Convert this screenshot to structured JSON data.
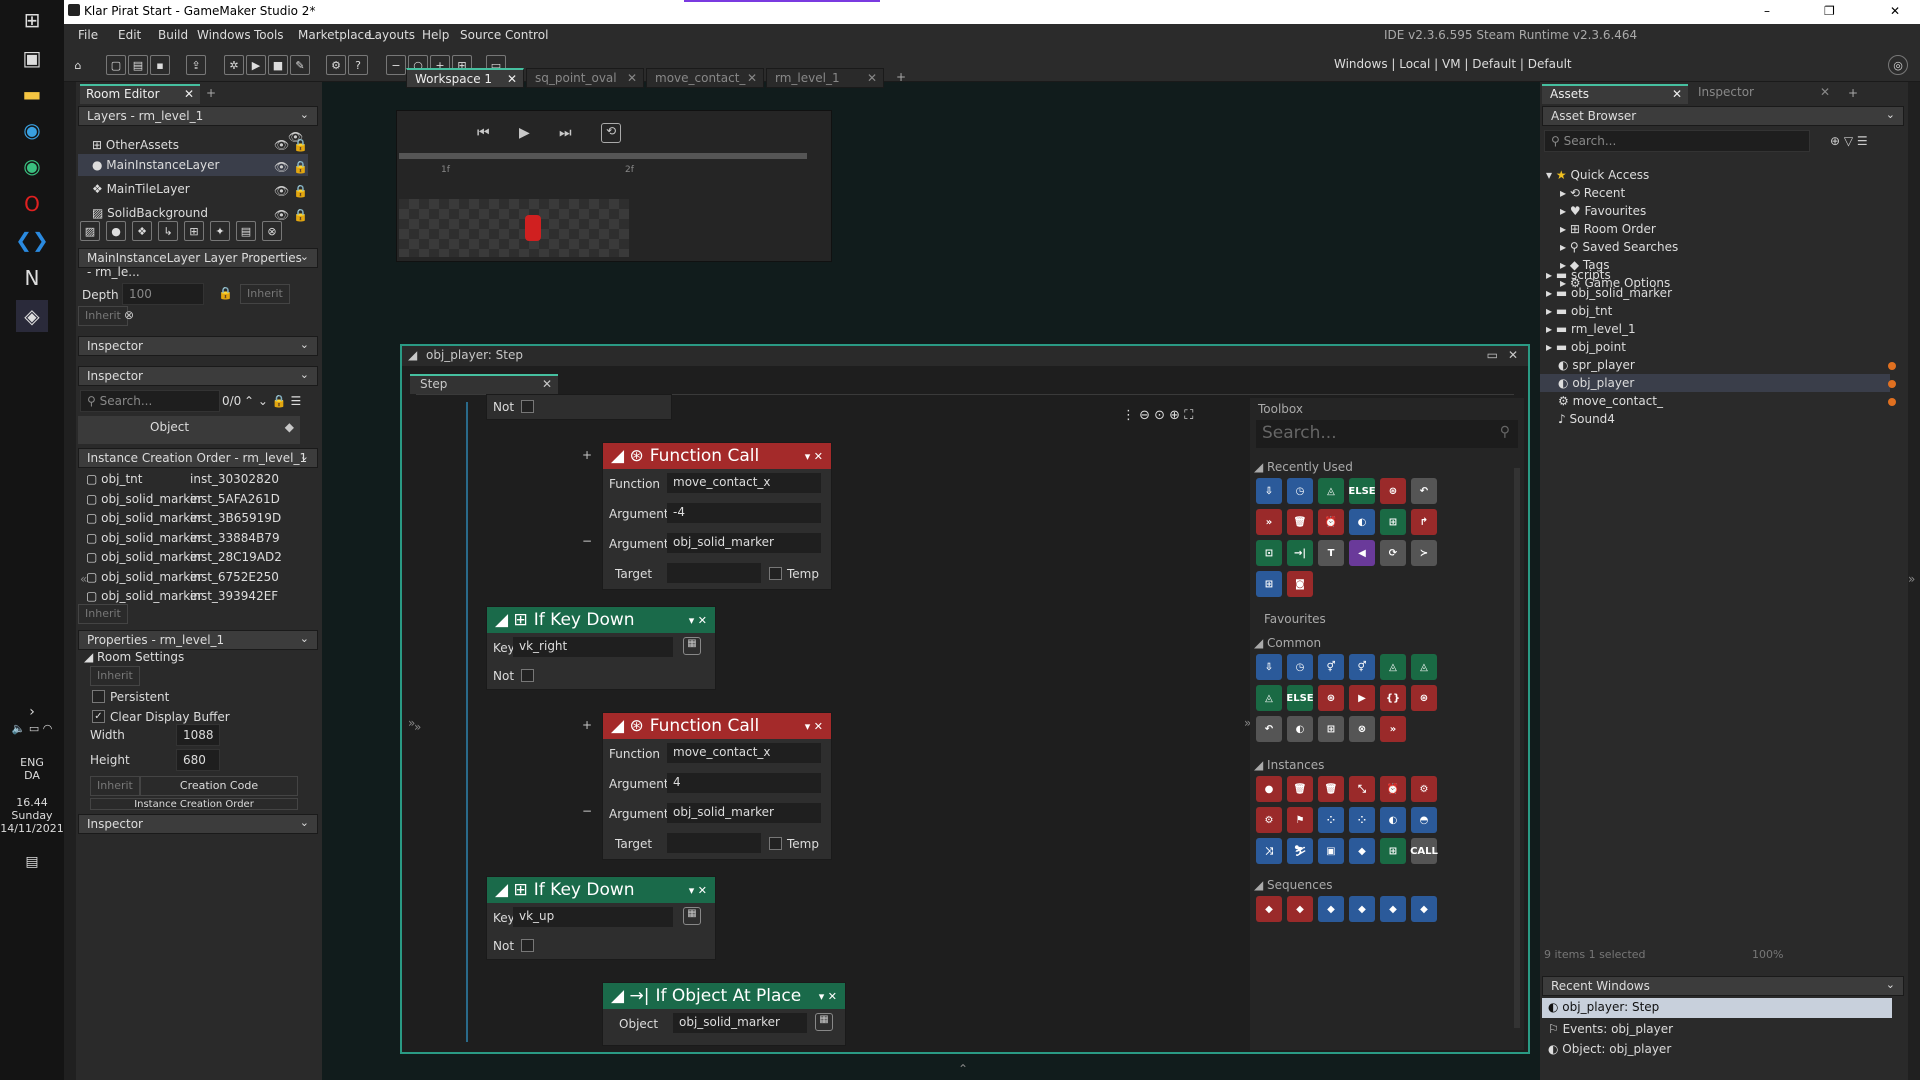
{
  "window": {
    "title": "Klar Pirat Start - GameMaker Studio 2*",
    "version": "IDE v2.3.6.595 Steam  Runtime v2.3.6.464",
    "controls": [
      "–",
      "❐",
      "✕"
    ]
  },
  "menu": [
    "File",
    "Edit",
    "Build",
    "Windows",
    "Tools",
    "Marketplace",
    "Layouts",
    "Help",
    "Source Control"
  ],
  "toolbar_right": "Windows  |  Local  |  VM  |  Default  |  Default",
  "left": {
    "tab": "Room Editor",
    "layers_header": "Layers - rm_level_1",
    "layers": [
      "OtherAssets",
      "MainInstanceLayer",
      "MainTileLayer",
      "SolidBackground"
    ],
    "layer_props": "MainInstanceLayer Layer Properties - rm_le...",
    "depth_label": "Depth",
    "depth_value": "100",
    "inherit": "Inherit",
    "inspector": "Inspector",
    "search": "Search...",
    "count": "0/0",
    "object_label": "Object",
    "ico_header": "Instance Creation Order - rm_level_1",
    "instances": [
      [
        "obj_tnt",
        "inst_30302820"
      ],
      [
        "obj_solid_marker",
        "inst_5AFA261D"
      ],
      [
        "obj_solid_marker",
        "inst_3B65919D"
      ],
      [
        "obj_solid_marker",
        "inst_33884B79"
      ],
      [
        "obj_solid_marker",
        "inst_28C19AD2"
      ],
      [
        "obj_solid_marker",
        "inst_6752E250"
      ],
      [
        "obj_solid_marker",
        "inst_393942EF"
      ]
    ],
    "props_header": "Properties - rm_level_1",
    "room_settings": "Room Settings",
    "persistent": "Persistent",
    "clear_display": "Clear Display Buffer",
    "width_label": "Width",
    "width_value": "1088",
    "height_label": "Height",
    "height_value": "680",
    "creation_code": "Creation Code",
    "instance_order": "Instance Creation Order"
  },
  "tabs": [
    "Workspace 1",
    "sq_point_oval",
    "move_contact_",
    "rm_level_1"
  ],
  "ruler": [
    "1f",
    "2f"
  ],
  "step_window": {
    "title": "obj_player: Step",
    "tab": "Step",
    "not": "Not"
  },
  "nodes": {
    "fc_title": "Function Call",
    "function_label": "Function",
    "function_value": "move_contact_x",
    "argument_label": "Argument",
    "arg1a": "-4",
    "arg1b": "obj_solid_marker",
    "arg2a": "4",
    "arg2b": "obj_solid_marker",
    "target_label": "Target",
    "temp_label": "Temp",
    "ikd_title": "If Key Down",
    "key_label": "Key",
    "key1": "vk_right",
    "key2": "vk_up",
    "iop_title": "If Object At Place",
    "object_label": "Object",
    "object_value": "obj_solid_marker"
  },
  "toolbox": {
    "title": "Toolbox",
    "search": "Search...",
    "recent": "Recently Used",
    "favourites": "Favourites",
    "common": "Common",
    "instances": "Instances",
    "sequences": "Sequences"
  },
  "assets": {
    "tab1": "Assets",
    "tab2": "Inspector",
    "header": "Asset Browser",
    "search": "Search...",
    "quick": "Quick Access",
    "quick_items": [
      "Recent",
      "Favourites",
      "Room Order",
      "Saved Searches",
      "Tags",
      "Game Options"
    ],
    "items": [
      "scripts",
      "obj_solid_marker",
      "obj_tnt",
      "rm_level_1",
      "obj_point",
      "spr_player",
      "obj_player",
      "move_contact_",
      "Sound4"
    ],
    "status": "9 items    1 selected",
    "zoom": "100%",
    "recent_header": "Recent Windows",
    "recent": [
      "obj_player: Step",
      "Events: obj_player",
      "Object: obj_player"
    ]
  },
  "clock": {
    "lang1": "ENG",
    "lang2": "DA",
    "time": "16.44",
    "day": "Sunday",
    "date": "14/11/2021"
  }
}
